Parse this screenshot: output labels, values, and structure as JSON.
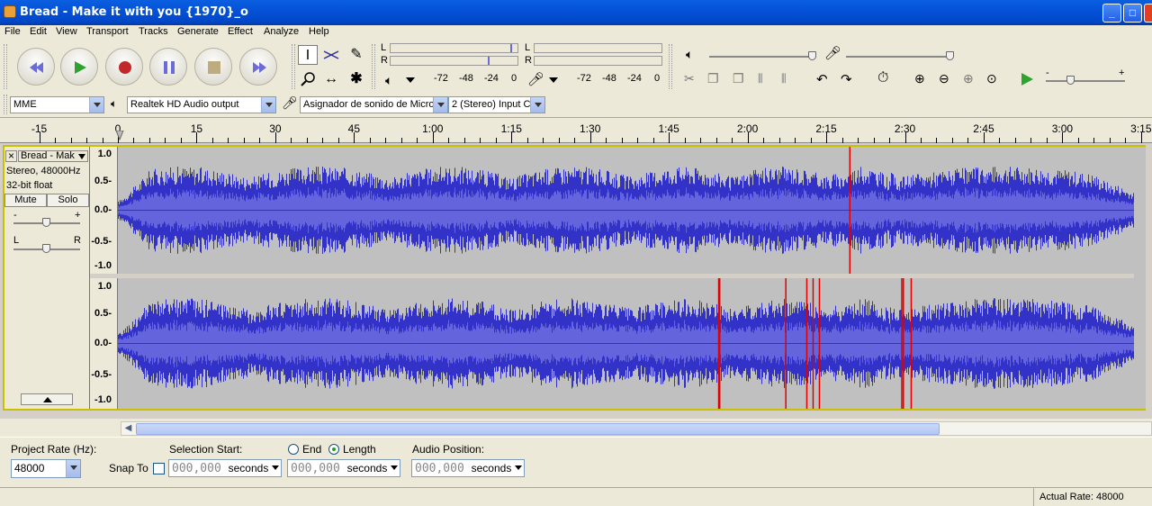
{
  "window": {
    "title": "Bread - Make it with you {1970}_o",
    "minimize": "_",
    "maximize": "□",
    "close": "✕",
    "close_color": "#e04020"
  },
  "menu": [
    "File",
    "Edit",
    "View",
    "Transport",
    "Tracks",
    "Generate",
    "Effect",
    "Analyze",
    "Help"
  ],
  "transport": {
    "buttons": [
      "skip-start",
      "play",
      "record",
      "pause",
      "stop",
      "skip-end"
    ],
    "play_color": "#2fa32f",
    "record_color": "#c0282a",
    "accent_color": "#6c6cd8"
  },
  "tools": [
    "selection-tool",
    "envelope-tool",
    "draw-tool",
    "zoom-tool",
    "timeshift-tool",
    "multi-tool"
  ],
  "meters": {
    "playback_ticks": [
      "-72",
      "-48",
      "-24",
      "0"
    ],
    "record_ticks": [
      "-72",
      "-48",
      "-24",
      "0"
    ],
    "channel_left": "L",
    "channel_right": "R"
  },
  "devices": {
    "host": "MME",
    "output": "Realtek HD Audio output",
    "input": "Asignador de sonido de Micros",
    "channels": "2 (Stereo) Input C"
  },
  "ruler": {
    "labels": [
      "-15",
      "0",
      "15",
      "30",
      "45",
      "1:00",
      "1:15",
      "1:30",
      "1:45",
      "2:00",
      "2:15",
      "2:30",
      "2:45",
      "3:00",
      "3:15"
    ],
    "seconds": [
      -15,
      0,
      15,
      30,
      45,
      60,
      75,
      90,
      105,
      120,
      135,
      150,
      165,
      180,
      195
    ],
    "view_start_seconds": -22.5,
    "seconds_per_label": 15
  },
  "track": {
    "name": "Bread - Mak",
    "close": "×",
    "info_rate": "Stereo, 48000Hz",
    "info_format": "32-bit float",
    "mute_label": "Mute",
    "solo_label": "Solo",
    "gain_minus": "-",
    "gain_plus": "+",
    "pan_left": "L",
    "pan_right": "R",
    "gain_level": 0.5,
    "pan_level": 0.5,
    "scale_labels": [
      "1.0",
      "0.5-",
      "0.0-",
      "-0.5-",
      "-1.0"
    ],
    "wave_color": "#3232c8",
    "rms_color": "#6464dc",
    "duration_seconds": 200,
    "clipping_seconds_left": [
      139.5
    ],
    "clipping_seconds_right": [
      114.5,
      114.7,
      127.3,
      131.3,
      132.5,
      133.7,
      149.4,
      149.7,
      151.2
    ]
  },
  "bottom": {
    "project_rate_label": "Project Rate (Hz):",
    "project_rate_value": "48000",
    "snap_to_label": "Snap To",
    "selection_start_label": "Selection Start:",
    "end_label": "End",
    "length_label": "Length",
    "audio_position_label": "Audio Position:",
    "time_value": "000,000",
    "time_unit": "seconds"
  },
  "status": {
    "actual_rate": "Actual Rate: 48000"
  }
}
